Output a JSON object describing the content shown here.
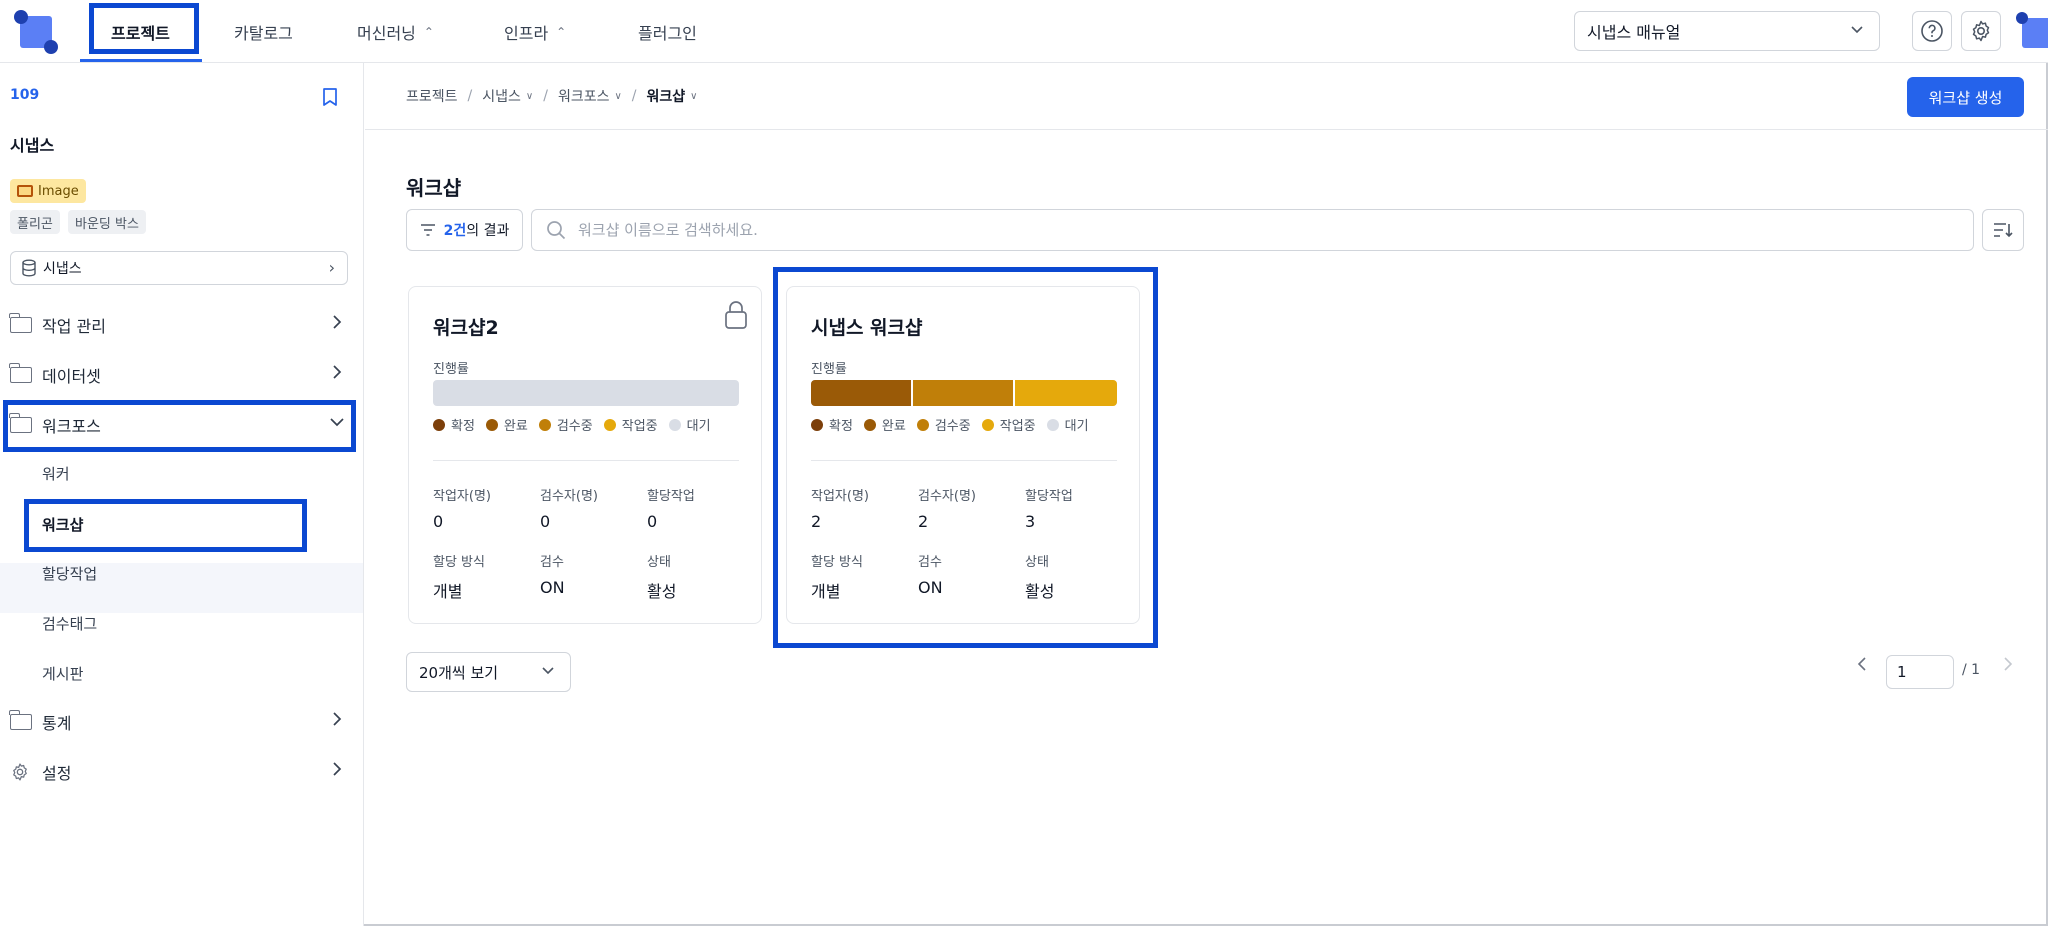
{
  "header": {
    "nav": [
      {
        "label": "프로젝트",
        "dropdown": false
      },
      {
        "label": "카탈로그",
        "dropdown": false
      },
      {
        "label": "머신러닝",
        "dropdown": true
      },
      {
        "label": "인프라",
        "dropdown": true
      },
      {
        "label": "플러그인",
        "dropdown": false
      }
    ],
    "active_nav": "프로젝트",
    "project_select": "시냅스 매뉴얼",
    "icons": [
      "help-icon",
      "gear-icon",
      "avatar"
    ]
  },
  "sidebar": {
    "project_id": "109",
    "project_name": "시냅스",
    "data_type_tag": "Image",
    "annotation_tags": [
      "폴리곤",
      "바운딩 박스"
    ],
    "dataset": "시냅스",
    "menu": [
      {
        "label": "작업 관리",
        "expanded": false
      },
      {
        "label": "데이터셋",
        "expanded": false
      },
      {
        "label": "워크포스",
        "expanded": true
      },
      {
        "label": "통계",
        "expanded": false
      },
      {
        "label": "설정",
        "expanded": false
      }
    ],
    "workforce_items": [
      "워커",
      "워크샵",
      "할당작업",
      "검수태그",
      "게시판"
    ],
    "active_item": "워크샵"
  },
  "main": {
    "breadcrumb": [
      "프로젝트",
      "시냅스",
      "워크포스",
      "워크샵"
    ],
    "create_button": "워크샵 생성",
    "title": "워크샵",
    "filter": {
      "count": "2건",
      "suffix": "의 결과"
    },
    "search_placeholder": "워크샵 이름으로 검색하세요.",
    "cards": [
      {
        "title": "워크샵2",
        "locked": true,
        "progress_label": "진행률",
        "progress": {
          "확정": 0,
          "완료": 0,
          "검수중": 0,
          "작업중": 0,
          "대기": 1
        },
        "legend": [
          "확정",
          "완료",
          "검수중",
          "작업중",
          "대기"
        ],
        "stats": [
          {
            "label": "작업자(명)",
            "value": "0"
          },
          {
            "label": "검수자(명)",
            "value": "0"
          },
          {
            "label": "할당작업",
            "value": "0"
          },
          {
            "label": "할당 방식",
            "value": "개별"
          },
          {
            "label": "검수",
            "value": "ON"
          },
          {
            "label": "상태",
            "value": "활성"
          }
        ]
      },
      {
        "title": "시냅스 워크샵",
        "locked": false,
        "progress_label": "진행률",
        "progress": {
          "확정": 0,
          "완료": 0.333,
          "검수중": 0.333,
          "작업중": 0.334,
          "대기": 0
        },
        "legend": [
          "확정",
          "완료",
          "검수중",
          "작업중",
          "대기"
        ],
        "stats": [
          {
            "label": "작업자(명)",
            "value": "2"
          },
          {
            "label": "검수자(명)",
            "value": "2"
          },
          {
            "label": "할당작업",
            "value": "3"
          },
          {
            "label": "할당 방식",
            "value": "개별"
          },
          {
            "label": "검수",
            "value": "ON"
          },
          {
            "label": "상태",
            "value": "활성"
          }
        ]
      }
    ],
    "per_page": "20개씩 보기",
    "pagination": {
      "current": "1",
      "total": "/ 1"
    }
  },
  "colors": {
    "accent": "#2563eb",
    "highlight": "#0b48d1",
    "status": {
      "확정": "#7c3f0a",
      "완료": "#9a5a07",
      "검수중": "#c07f09",
      "작업중": "#e5a90c",
      "대기": "#d9dde5"
    }
  }
}
